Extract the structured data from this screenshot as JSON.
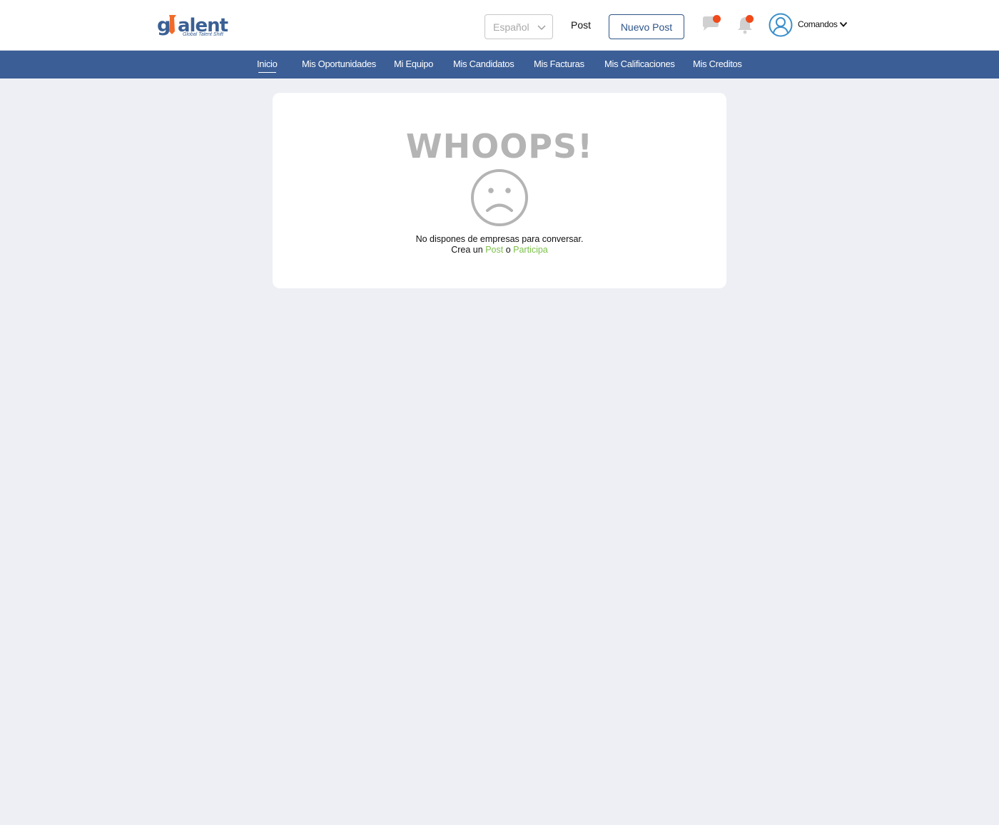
{
  "header": {
    "logo_text": "gtalents",
    "logo_tagline": "Global Talent Shift",
    "language": {
      "selected": "Español"
    },
    "post_link": "Post",
    "new_post_button": "Nuevo Post",
    "chat_icon": "chat-bubble-icon",
    "notifications_icon": "bell-icon",
    "badge_color": "#f04a1a",
    "user_menu_label": "Comandos"
  },
  "nav": {
    "items": [
      {
        "label": "Inicio",
        "active": true
      },
      {
        "label": "Mis Oportunidades"
      },
      {
        "label": "Mi Equipo"
      },
      {
        "label": "Mis Candidatos"
      },
      {
        "label": "Mis Facturas"
      },
      {
        "label": "Mis Calificaciones"
      },
      {
        "label": "Mis Creditos"
      }
    ],
    "background": "#3b5e96"
  },
  "empty_state": {
    "title": "WHOOPS!",
    "icon": "sad-face-icon",
    "message": "No dispones de empresas para conversar.",
    "cta_prefix": "Crea un",
    "cta_post": "Post",
    "cta_join": "o",
    "cta_participate": "Participa",
    "link_color": "#7cc04a"
  }
}
